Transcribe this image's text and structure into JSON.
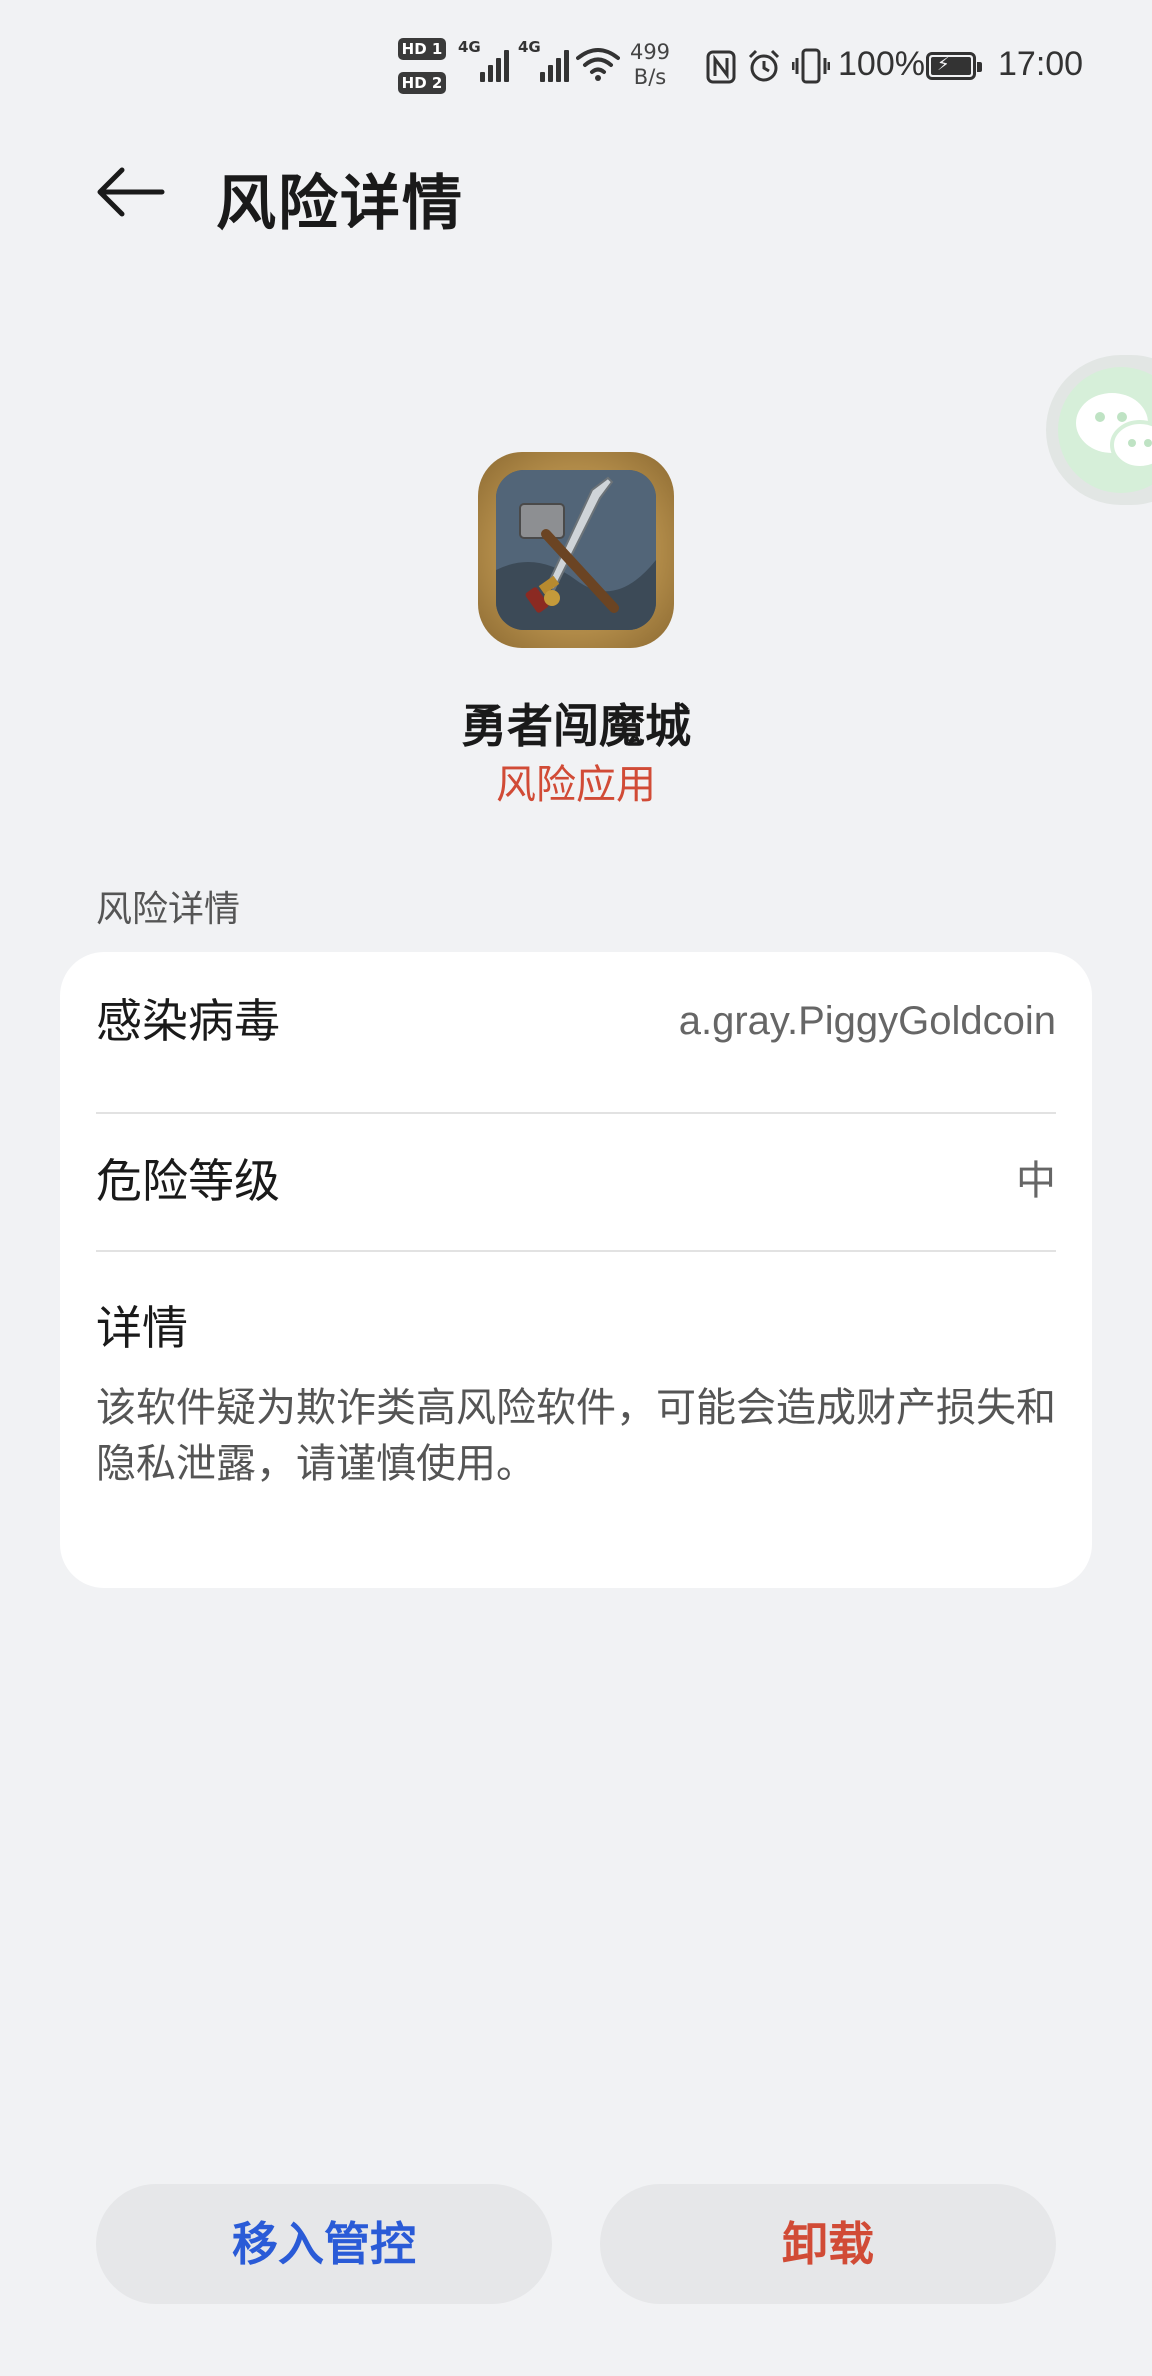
{
  "status_bar": {
    "sim1": "HD 1",
    "sim2": "HD 2",
    "net_type_1": "4G",
    "net_type_2": "4G",
    "net_speed_value": "499",
    "net_speed_unit": "B/s",
    "battery_percent": "100%",
    "time": "17:00"
  },
  "header": {
    "title": "风险详情"
  },
  "app": {
    "name": "勇者闯魔城",
    "status": "风险应用"
  },
  "section": {
    "label": "风险详情"
  },
  "details": {
    "virus_label": "感染病毒",
    "virus_value": "a.gray.PiggyGoldcoin",
    "level_label": "危险等级",
    "level_value": "中",
    "details_label": "详情",
    "details_text": "该软件疑为欺诈类高风险软件，可能会造成财产损失和隐私泄露，请谨慎使用。"
  },
  "actions": {
    "manage_label": "移入管控",
    "uninstall_label": "卸载"
  },
  "colors": {
    "background": "#f1f2f4",
    "risk_red": "#d14b36",
    "action_blue": "#2a5bd7",
    "card_bg": "#ffffff"
  }
}
